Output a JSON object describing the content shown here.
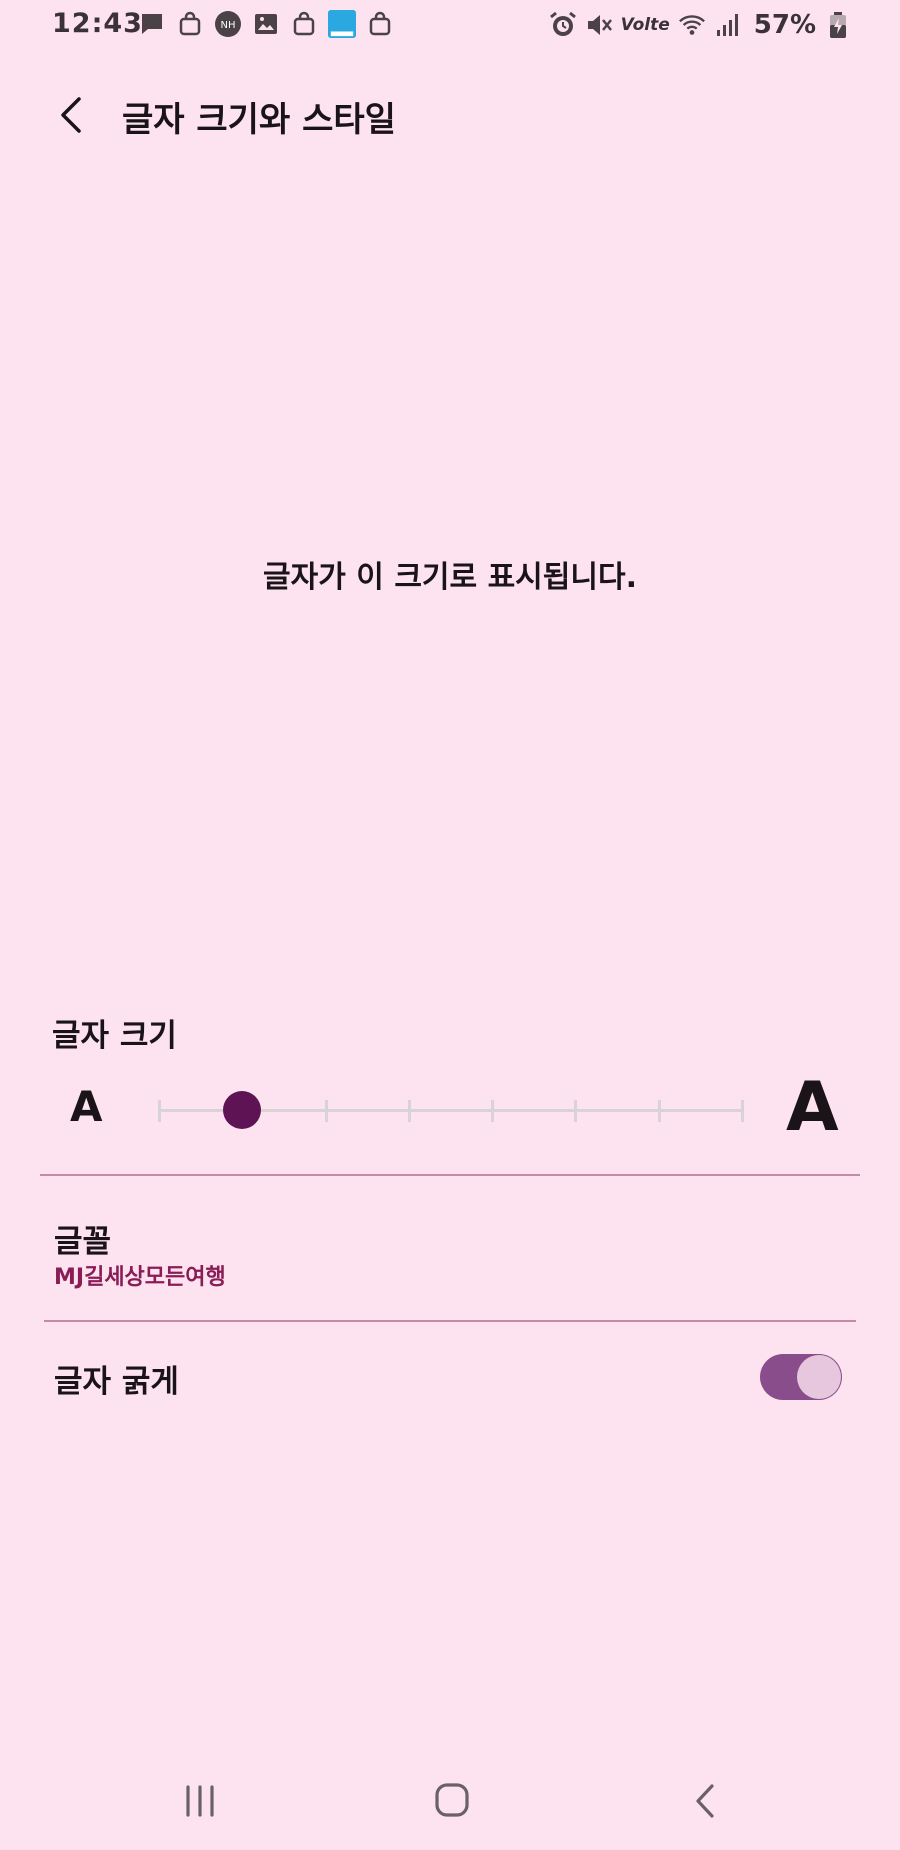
{
  "status_bar": {
    "time": "12:43",
    "network": "Volte",
    "battery": "57%"
  },
  "header": {
    "title": "글자 크기와 스타일"
  },
  "preview": {
    "text": "글자가 이 크기로 표시됩니다."
  },
  "font_size": {
    "label": "글자 크기",
    "small_glyph": "A",
    "large_glyph": "A",
    "steps": 8,
    "selected_step": 1
  },
  "font": {
    "label": "글꼴",
    "value": "MJ길세상모든여행"
  },
  "bold": {
    "label": "글자 굵게",
    "enabled": true
  },
  "colors": {
    "background": "#fde3ef",
    "accent": "#5e1355",
    "font_value": "#8a1c56",
    "toggle_track": "#8a4d8c"
  }
}
